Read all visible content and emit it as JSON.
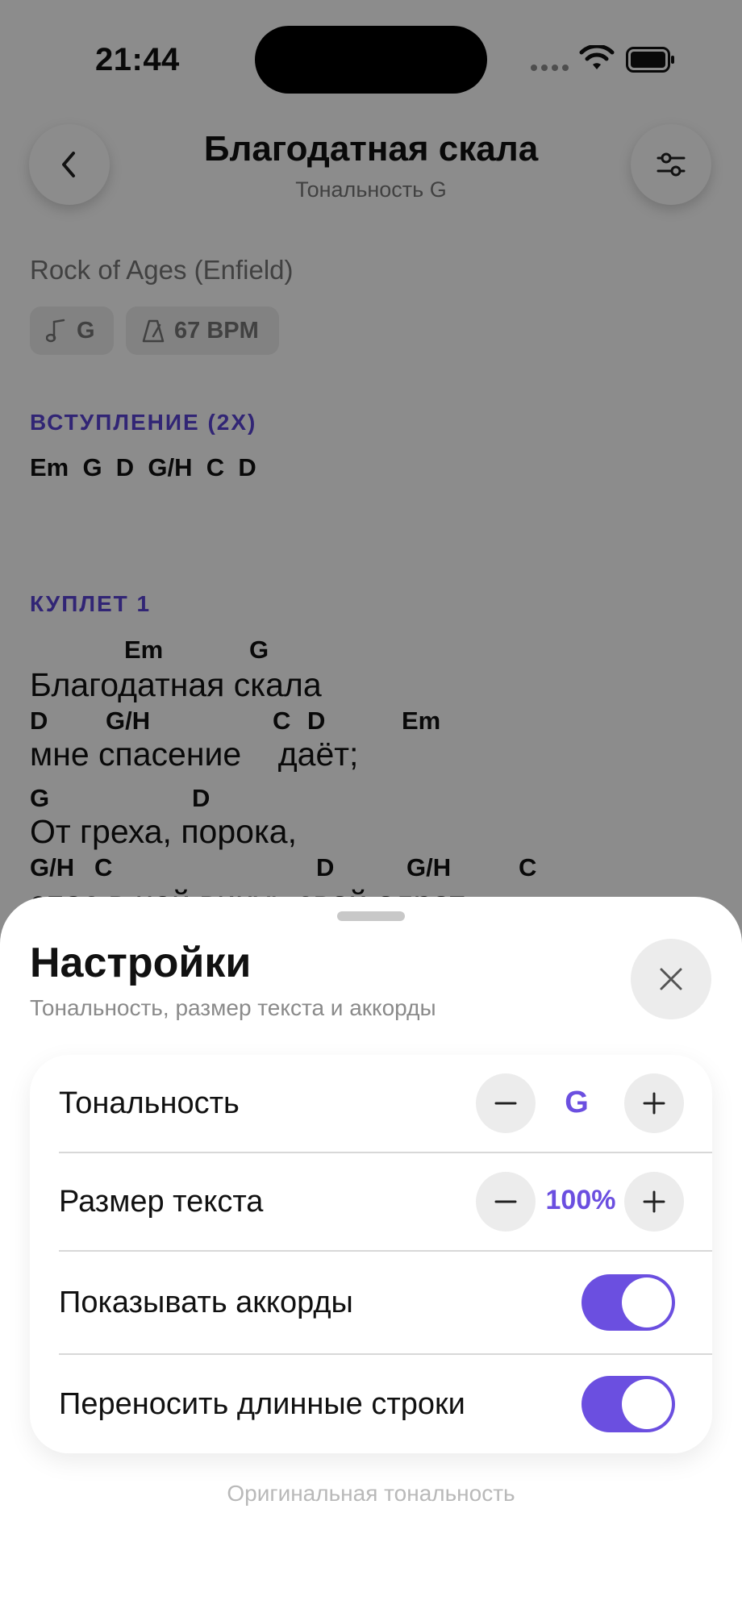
{
  "status_bar": {
    "time": "21:44"
  },
  "header": {
    "title": "Благодатная скала",
    "subtitle": "Тональность G"
  },
  "song": {
    "original_name": "Rock of Ages (Enfield)",
    "chips": {
      "key": "G",
      "bpm": "67 BPM"
    },
    "sections": [
      {
        "label": "ВСТУПЛЕНИЕ (2X)",
        "chords": "Em  G  D  G/H  C  D"
      },
      {
        "label": "КУПЛЕТ 1"
      }
    ],
    "verse": {
      "chords_1": [
        "Em",
        "G"
      ],
      "lyric_1": "Благодатная скала",
      "chords_2": [
        "D",
        "G/H",
        "C",
        "D",
        "Em"
      ],
      "lyric_2": "мне спасение    даёт;",
      "chords_3": [
        "G",
        "D"
      ],
      "lyric_3": "От греха, порока,",
      "chords_4": [
        "G/H",
        "C",
        "D",
        "G/H",
        "C"
      ],
      "lyric_4": "спас в ней винуь свой олрот"
    }
  },
  "settings_sheet": {
    "title": "Настройки",
    "subtitle": "Тональность, размер текста и аккорды",
    "rows": {
      "key": {
        "label": "Тональность",
        "value": "G",
        "minus": "−",
        "plus": "+"
      },
      "text_size": {
        "label": "Размер текста",
        "value": "100%",
        "minus": "−",
        "plus": "+"
      },
      "show_chords": {
        "label": "Показывать аккорды",
        "enabled": true
      },
      "wrap_lines": {
        "label": "Переносить длинные строки",
        "enabled": true
      }
    },
    "original_key_link": "Оригинальная тональность"
  },
  "colors": {
    "accent": "#6b4fe0",
    "section_label": "#5a44d6"
  }
}
